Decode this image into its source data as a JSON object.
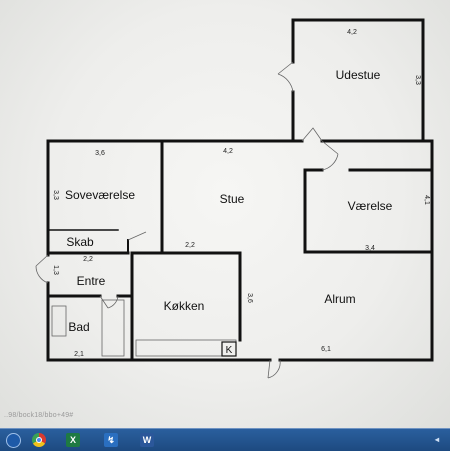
{
  "floorplan": {
    "rooms": {
      "udestue": "Udestue",
      "sovevaerelse": "Soveværelse",
      "stue": "Stue",
      "vaerelse": "Værelse",
      "skab": "Skab",
      "entre": "Entre",
      "kokken": "Køkken",
      "alrum": "Alrum",
      "bad": "Bad"
    },
    "dimensions": {
      "udestue_width": "4,2",
      "udestue_depth": "3,3",
      "sovevaerelse_width": "3,6",
      "sovevaerelse_depth": "3,3",
      "stue_width": "4,2",
      "stue_depth": "2,2",
      "vaerelse_depth": "4,1",
      "vaerelse_width": "3,4",
      "skab_width": "2,2",
      "entre_depth": "1,3",
      "kokken_depth": "3,6",
      "alrum_width": "6,1",
      "bad_width": "2,1"
    },
    "kitchen_marker": "K"
  },
  "status_text": "..98/bock18/bbo+49#",
  "taskbar": {
    "start": "",
    "chrome": "",
    "excel": "X",
    "app": "↯",
    "word": "W",
    "tray": "◂"
  }
}
